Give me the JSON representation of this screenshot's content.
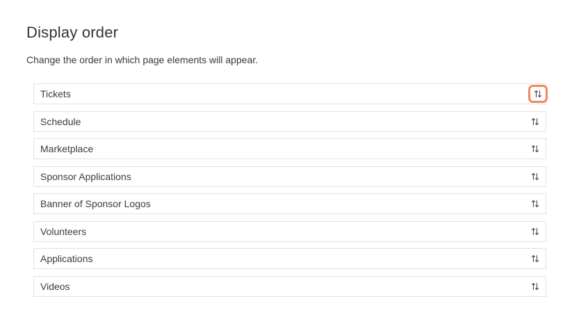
{
  "header": {
    "title": "Display order",
    "description": "Change the order in which page elements will appear."
  },
  "order_list": {
    "items": [
      {
        "label": "Tickets",
        "focused": true
      },
      {
        "label": "Schedule",
        "focused": false
      },
      {
        "label": "Marketplace",
        "focused": false
      },
      {
        "label": "Sponsor Applications",
        "focused": false
      },
      {
        "label": "Banner of Sponsor Logos",
        "focused": false
      },
      {
        "label": "Volunteers",
        "focused": false
      },
      {
        "label": "Applications",
        "focused": false
      },
      {
        "label": "Videos",
        "focused": false
      }
    ],
    "handle_icon": "sort-arrows-icon"
  },
  "colors": {
    "focus_ring": "#f0875f",
    "border": "#e1e1e1",
    "text": "#3c3c3c"
  }
}
